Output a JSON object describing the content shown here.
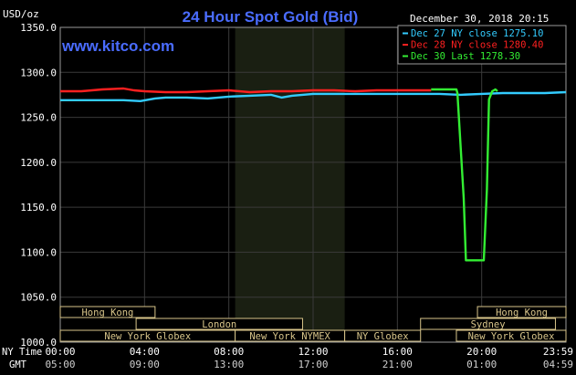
{
  "chart_data": {
    "type": "line",
    "title": "24 Hour Spot Gold (Bid)",
    "brand": "www.kitco.com",
    "timestamp": "December 30, 2018 20:15",
    "y_unit": "USD/oz",
    "ylim": [
      1000,
      1350
    ],
    "y_ticks": [
      1000,
      1050,
      1100,
      1150,
      1200,
      1250,
      1300,
      1350
    ],
    "y_tick_labels": [
      "1000.0",
      "1050.0",
      "1100.0",
      "1150.0",
      "1200.0",
      "1250.0",
      "1300.0",
      "1350.0"
    ],
    "x_range_hours": [
      0,
      24
    ],
    "x_ticks_hours": [
      0,
      4,
      8,
      12,
      16,
      20,
      24
    ],
    "x_row_ny_label": "NY Time",
    "x_row_gmt_label": "GMT",
    "x_ticks_ny": [
      "00:00",
      "04:00",
      "08:00",
      "12:00",
      "16:00",
      "20:00",
      "23:59"
    ],
    "x_ticks_gmt": [
      "05:00",
      "09:00",
      "13:00",
      "17:00",
      "21:00",
      "01:00",
      "04:59"
    ],
    "highlight_range_hours": [
      8.3,
      13.5
    ],
    "grid": true,
    "legend_position": "top-right",
    "colors": {
      "background": "#000000",
      "grid": "#3a3a3a",
      "title": "#4a6cff",
      "session": "#d8c58a",
      "text": "#ffffff"
    },
    "series": [
      {
        "name": "Dec 27 NY close 1275.10",
        "color": "#33ccff",
        "x": [
          0,
          1,
          2,
          3,
          3.8,
          4.5,
          5,
          6,
          7,
          8,
          9,
          10,
          10.5,
          11,
          12,
          13,
          14,
          15,
          16,
          17,
          18,
          19,
          20,
          21,
          22,
          23,
          24
        ],
        "y": [
          1269,
          1269,
          1269,
          1269,
          1268,
          1271,
          1272,
          1272,
          1271,
          1273,
          1274,
          1275,
          1272,
          1274,
          1276,
          1276,
          1276,
          1276,
          1276,
          1276,
          1276,
          1275,
          1276,
          1277,
          1277,
          1277,
          1278
        ]
      },
      {
        "name": "Dec 28 NY close 1280.40",
        "color": "#ff2020",
        "x": [
          0,
          1,
          2,
          3,
          3.5,
          4,
          5,
          6,
          7,
          8,
          9,
          10,
          11,
          12,
          13,
          14,
          15,
          16,
          17,
          17.6
        ],
        "y": [
          1279,
          1279,
          1281,
          1282,
          1280,
          1279,
          1278,
          1278,
          1279,
          1280,
          1278,
          1279,
          1279,
          1280,
          1280,
          1279,
          1280,
          1280,
          1280,
          1280
        ]
      },
      {
        "name": "Dec 30 Last 1278.30",
        "color": "#33ee33",
        "x": [
          17.6,
          18.8,
          18.85,
          19.15,
          19.25,
          20.1,
          20.25,
          20.35,
          20.5,
          20.65,
          20.75
        ],
        "y": [
          1281,
          1281,
          1277,
          1160,
          1091,
          1091,
          1170,
          1270,
          1279,
          1281,
          1279
        ]
      }
    ],
    "sessions": [
      {
        "label": "Hong Kong",
        "row": 0,
        "start": 0,
        "end": 4.5
      },
      {
        "label": "London",
        "row": 1,
        "start": 3.6,
        "end": 11.5
      },
      {
        "label": "New York Globex",
        "row": 2,
        "start": 0,
        "end": 8.3
      },
      {
        "label": "New York NYMEX",
        "row": 2,
        "start": 8.3,
        "end": 13.5
      },
      {
        "label": "NY Globex",
        "row": 2,
        "start": 13.5,
        "end": 17.1
      },
      {
        "label": "Hong Kong",
        "row": 0,
        "start": 19.8,
        "end": 24
      },
      {
        "label": "Sydney",
        "row": 1,
        "start": 17.1,
        "end": 23.5
      },
      {
        "label": "New York Globex",
        "row": 2,
        "start": 18.8,
        "end": 24
      }
    ]
  }
}
